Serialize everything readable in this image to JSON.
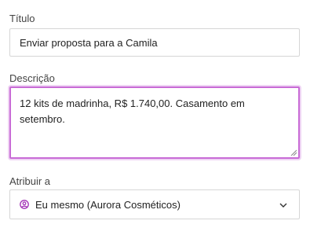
{
  "form": {
    "title_label": "Título",
    "title_value": "Enviar proposta para a Camila",
    "description_label": "Descrição",
    "description_value": "12 kits de madrinha, R$ 1.740,00. Casamento em setembro.",
    "assign_label": "Atribuir a",
    "assign_value": "Eu mesmo (Aurora Cosméticos)"
  },
  "colors": {
    "focus_border": "#c86bd6",
    "focus_ring": "#efd4f4",
    "user_icon": "#a12fb5"
  },
  "icons": {
    "assignee": "user-circle-icon",
    "dropdown": "chevron-down-icon",
    "resize": "resize-grip-icon"
  }
}
